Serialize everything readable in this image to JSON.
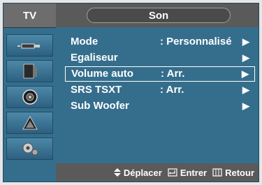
{
  "sidebar": {
    "title": "TV",
    "items": [
      {
        "icon": "antenna-icon"
      },
      {
        "icon": "picture-icon"
      },
      {
        "icon": "speaker-icon"
      },
      {
        "icon": "satellite-dish-icon"
      },
      {
        "icon": "gear-icon"
      }
    ]
  },
  "header": {
    "title": "Son"
  },
  "menu": {
    "rows": [
      {
        "label": "Mode",
        "value": ": Personnalisé",
        "arrow": "▶"
      },
      {
        "label": "Egaliseur",
        "value": "",
        "arrow": "▶"
      },
      {
        "label": "Volume auto",
        "value": ": Arr.",
        "arrow": "▶"
      },
      {
        "label": "SRS TSXT",
        "value": ": Arr.",
        "arrow": "▶"
      },
      {
        "label": "Sub Woofer",
        "value": "",
        "arrow": "▶"
      }
    ],
    "selected_index": 2
  },
  "footer": {
    "move_label": "Déplacer",
    "enter_label": "Entrer",
    "return_label": "Retour"
  },
  "colors": {
    "panel": "#356e8c",
    "header": "#5a5a5a",
    "text": "#ffffff"
  }
}
